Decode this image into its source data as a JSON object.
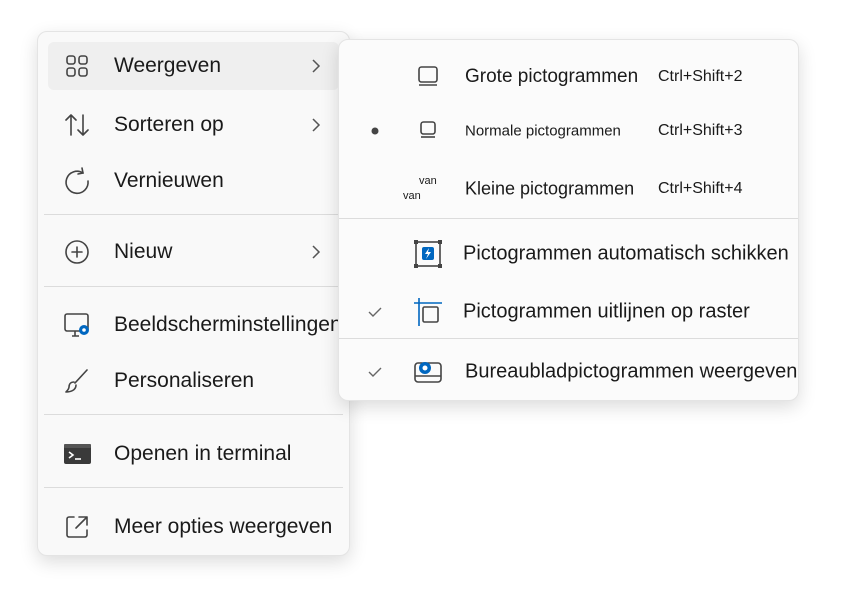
{
  "main_menu": {
    "items": [
      {
        "label": "Weergeven",
        "icon": "grid-icon",
        "has_submenu": true,
        "highlighted": true
      },
      {
        "label": "Sorteren op",
        "icon": "sort-arrows-icon",
        "has_submenu": true
      },
      {
        "label": "Vernieuwen",
        "icon": "refresh-icon",
        "has_submenu": false
      },
      {
        "label": "Nieuw",
        "icon": "plus-circle-icon",
        "has_submenu": true
      },
      {
        "label": "Beeldscherminstellingen",
        "icon": "display-settings-icon",
        "has_submenu": false
      },
      {
        "label": "Personaliseren",
        "icon": "brush-icon",
        "has_submenu": false
      },
      {
        "label": "Openen in terminal",
        "icon": "terminal-icon",
        "has_submenu": false
      },
      {
        "label": "Meer opties weergeven",
        "icon": "open-external-icon",
        "has_submenu": false
      }
    ]
  },
  "sub_menu": {
    "items": [
      {
        "label": "Grote pictogrammen",
        "shortcut": "Ctrl+Shift+2",
        "icon": "large-icons-icon",
        "mark": "none"
      },
      {
        "label": "Normale pictogrammen",
        "shortcut": "Ctrl+Shift+3",
        "icon": "medium-icons-icon",
        "mark": "bullet"
      },
      {
        "label": "Kleine pictogrammen",
        "shortcut": "Ctrl+Shift+4",
        "icon": "small-icons-icon",
        "mark": "none",
        "icon_text_1": "van",
        "icon_text_2": "van"
      },
      {
        "label": "Pictogrammen automatisch schikken",
        "icon": "auto-arrange-icon",
        "mark": "none"
      },
      {
        "label": "Pictogrammen uitlijnen op raster",
        "icon": "align-grid-icon",
        "mark": "check"
      },
      {
        "label": "Bureaubladpictogrammen weergeven",
        "icon": "show-desktop-icons-icon",
        "mark": "check"
      }
    ]
  },
  "colors": {
    "accent": "#0067c0",
    "icon": "#444444",
    "menu_bg": "#f9f9f9",
    "separator": "#dcdcdc"
  }
}
